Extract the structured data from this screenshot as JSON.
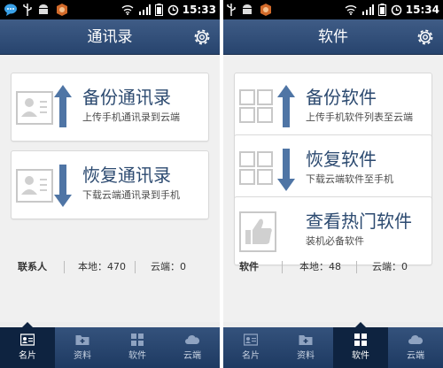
{
  "left_screen": {
    "status": {
      "time": "15:33"
    },
    "title": "通讯录",
    "cards": [
      {
        "title": "备份通讯录",
        "subtitle": "上传手机通讯录到云端",
        "icon": "contact-upload-icon"
      },
      {
        "title": "恢复通讯录",
        "subtitle": "下载云端通讯录到手机",
        "icon": "contact-download-icon"
      }
    ],
    "stats": {
      "label": "联系人",
      "local": "本地：470",
      "cloud": "云端：0"
    },
    "tabs": [
      {
        "label": "名片",
        "active": true
      },
      {
        "label": "资料",
        "active": false
      },
      {
        "label": "软件",
        "active": false
      },
      {
        "label": "云端",
        "active": false
      }
    ]
  },
  "right_screen": {
    "status": {
      "time": "15:34"
    },
    "title": "软件",
    "cards": [
      {
        "title": "备份软件",
        "subtitle": "上传手机软件列表至云端",
        "icon": "apps-upload-icon"
      },
      {
        "title": "恢复软件",
        "subtitle": "下载云端软件至手机",
        "icon": "apps-download-icon"
      },
      {
        "title": "查看热门软件",
        "subtitle": "装机必备软件",
        "icon": "thumbs-up-icon"
      }
    ],
    "stats": {
      "label": "软件",
      "local": "本地：48",
      "cloud": "云端：0"
    },
    "tabs": [
      {
        "label": "名片",
        "active": false
      },
      {
        "label": "资料",
        "active": false
      },
      {
        "label": "软件",
        "active": true
      },
      {
        "label": "云端",
        "active": false
      }
    ]
  },
  "colors": {
    "title_bar": "#2f4d78",
    "tab_bar": "#27446e",
    "card_title": "#2c4a70"
  }
}
